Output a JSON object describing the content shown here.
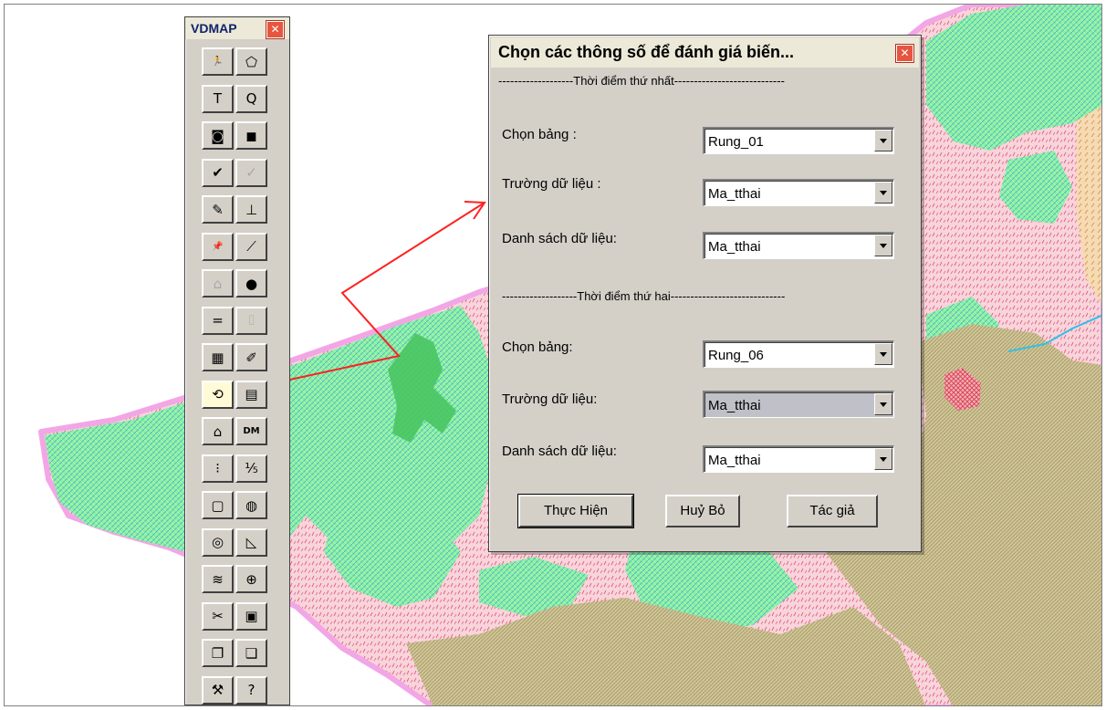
{
  "toolbox": {
    "title": "VDMAP",
    "close_glyph": "✕",
    "tools": [
      {
        "icon": "run-icon",
        "glyph": "🏃"
      },
      {
        "icon": "polygon-icon",
        "glyph": "⬠"
      },
      {
        "icon": "text-icon",
        "glyph": "T"
      },
      {
        "icon": "query-icon",
        "glyph": "Q"
      },
      {
        "icon": "select-region-icon",
        "glyph": "◙"
      },
      {
        "icon": "select-all-icon",
        "glyph": "◼"
      },
      {
        "icon": "check-icon",
        "glyph": "✔"
      },
      {
        "icon": "check-disabled-icon",
        "glyph": "✓"
      },
      {
        "icon": "pencil-icon",
        "glyph": "✎"
      },
      {
        "icon": "chart-axis-icon",
        "glyph": "⊥"
      },
      {
        "icon": "pin-info-icon",
        "glyph": "📌"
      },
      {
        "icon": "line-info-icon",
        "glyph": "⟋"
      },
      {
        "icon": "house-query-icon",
        "glyph": "⌂"
      },
      {
        "icon": "record-icon",
        "glyph": "●"
      },
      {
        "icon": "equal-icon",
        "glyph": "="
      },
      {
        "icon": "camera-icon",
        "glyph": "⌷"
      },
      {
        "icon": "layout-icon",
        "glyph": "▦"
      },
      {
        "icon": "tag-icon",
        "glyph": "✐"
      },
      {
        "icon": "change-detection-icon",
        "glyph": "⟲"
      },
      {
        "icon": "report-icon",
        "glyph": "▤"
      },
      {
        "icon": "house-icon",
        "glyph": "⌂"
      },
      {
        "icon": "dm-icon",
        "glyph": "DM"
      },
      {
        "icon": "traffic-light-icon",
        "glyph": "⁝"
      },
      {
        "icon": "scale-icon",
        "glyph": "⅕"
      },
      {
        "icon": "frame-icon",
        "glyph": "▢"
      },
      {
        "icon": "globe-icon",
        "glyph": "◍"
      },
      {
        "icon": "grid-globe-icon",
        "glyph": "◎"
      },
      {
        "icon": "edit-page-icon",
        "glyph": "◺"
      },
      {
        "icon": "layers-icon",
        "glyph": "≋"
      },
      {
        "icon": "world-window-icon",
        "glyph": "⊕"
      },
      {
        "icon": "cut-page-icon",
        "glyph": "✂"
      },
      {
        "icon": "save-icon",
        "glyph": "▣"
      },
      {
        "icon": "copy-icon",
        "glyph": "❐"
      },
      {
        "icon": "paste-icon",
        "glyph": "❏"
      },
      {
        "icon": "tools-icon",
        "glyph": "⚒"
      },
      {
        "icon": "help-icon",
        "glyph": "?"
      }
    ]
  },
  "dialog": {
    "title": "Chọn các thông số để đánh giá biến...",
    "close_glyph": "✕",
    "section1": "-------------------Thời điểm thứ nhất----------------------------",
    "section2": "-------------------Thời điểm thứ hai-----------------------------",
    "first": {
      "table_label": "Chọn bảng :",
      "table_value": "Rung_01",
      "field_label": "Trường dữ liệu :",
      "field_value": "Ma_tthai",
      "list_label": "Danh sách dữ liệu:",
      "list_value": "Ma_tthai"
    },
    "second": {
      "table_label": "Chọn bảng:",
      "table_value": "Rung_06",
      "field_label": "Trường dữ liệu:",
      "field_value": "Ma_tthai",
      "list_label": "Danh sách dữ liệu:",
      "list_value": "Ma_tthai"
    },
    "buttons": {
      "execute": "Thực Hiện",
      "cancel": "Huỷ Bỏ",
      "author": "Tác giả"
    }
  },
  "colors": {
    "map_green": "#7de88f",
    "map_pink": "#f5c9d2",
    "map_khaki": "#c9bd8c",
    "map_orange": "#f3d3a4",
    "map_border": "#f2a6e6",
    "arrow": "#ff2020",
    "window_bg": "#d4d0c8",
    "titlebar": "#ece9d8",
    "close_button": "#e8553f"
  }
}
